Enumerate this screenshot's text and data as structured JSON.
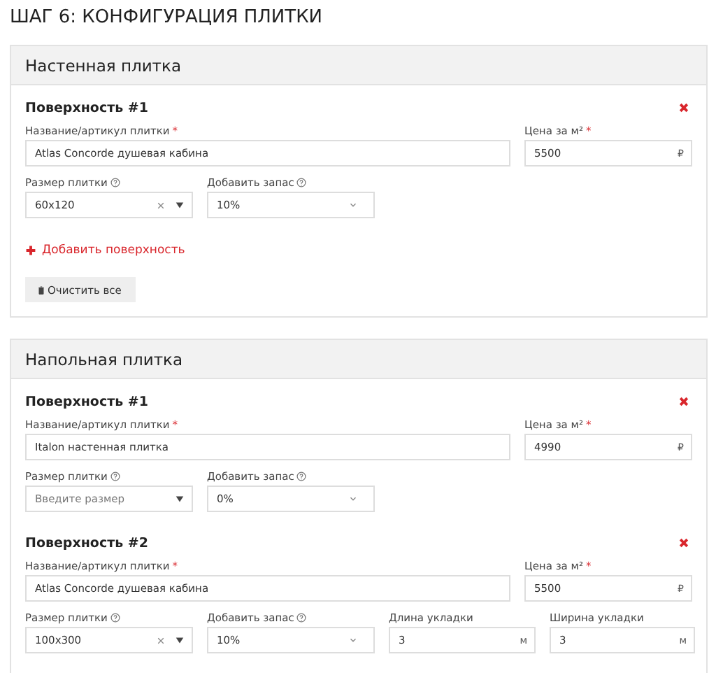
{
  "title": "ШАГ 6: КОНФИГУРАЦИЯ ПЛИТКИ",
  "sections": [
    {
      "title": "Настенная плитка",
      "surfaces": [
        {
          "title": "Поверхность #1",
          "name": {
            "label": "Название/артикул плитки",
            "required_mark": "*",
            "value": "Atlas Concorde душевая кабина"
          },
          "price": {
            "label": "Цена за м²",
            "required_mark": "*",
            "value": "5500",
            "unit": "₽"
          },
          "size": {
            "label": "Размер плитки",
            "value": "60x120"
          },
          "reserve": {
            "label": "Добавить запас",
            "value": "10%"
          }
        }
      ],
      "add_link": "Добавить поверхность",
      "clear_button": "Очистить все"
    },
    {
      "title": "Напольная плитка",
      "surfaces": [
        {
          "title": "Поверхность #1",
          "name": {
            "label": "Название/артикул плитки",
            "required_mark": "*",
            "value": "Italon настенная плитка"
          },
          "price": {
            "label": "Цена за м²",
            "required_mark": "*",
            "value": "4990",
            "unit": "₽"
          },
          "size": {
            "label": "Размер плитки",
            "placeholder": "Введите размер"
          },
          "reserve": {
            "label": "Добавить запас",
            "value": "0%"
          }
        },
        {
          "title": "Поверхность #2",
          "name": {
            "label": "Название/артикул плитки",
            "required_mark": "*",
            "value": "Atlas Concorde душевая кабина"
          },
          "price": {
            "label": "Цена за м²",
            "required_mark": "*",
            "value": "5500",
            "unit": "₽"
          },
          "size": {
            "label": "Размер плитки",
            "value": "100x300"
          },
          "reserve": {
            "label": "Добавить запас",
            "value": "10%"
          },
          "length": {
            "label": "Длина укладки",
            "value": "3",
            "unit": "м"
          },
          "width": {
            "label": "Ширина укладки",
            "value": "3",
            "unit": "м"
          }
        }
      ]
    }
  ]
}
